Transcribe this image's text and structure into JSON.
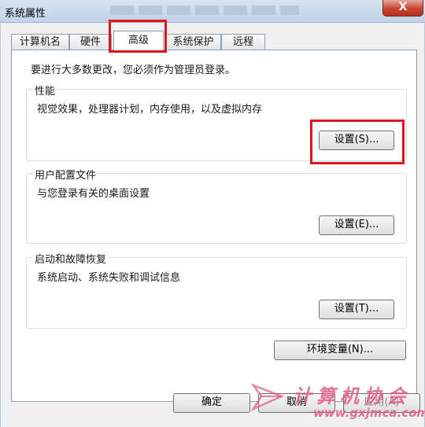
{
  "window": {
    "title": "系统属性",
    "close_label": "X"
  },
  "tabs": [
    {
      "label": "计算机名"
    },
    {
      "label": "硬件"
    },
    {
      "label": "高级"
    },
    {
      "label": "系统保护"
    },
    {
      "label": "远程"
    }
  ],
  "notice": "要进行大多数更改，您必须作为管理员登录。",
  "groups": {
    "performance": {
      "title": "性能",
      "description": "视觉效果，处理器计划，内存使用，以及虚拟内存",
      "button": "设置(S)..."
    },
    "profiles": {
      "title": "用户配置文件",
      "description": "与您登录有关的桌面设置",
      "button": "设置(E)..."
    },
    "startup": {
      "title": "启动和故障恢复",
      "description": "系统启动、系统失败和调试信息",
      "button": "设置(T)..."
    }
  },
  "env_button": "环境变量(N)...",
  "footer": {
    "ok": "确定",
    "cancel": "取消",
    "apply": "应用(A)"
  },
  "watermark": {
    "title": "计算机协会",
    "url": "www.gxjmca.com"
  },
  "colors": {
    "highlight": "#e0131f",
    "watermark": "#e05b86"
  }
}
